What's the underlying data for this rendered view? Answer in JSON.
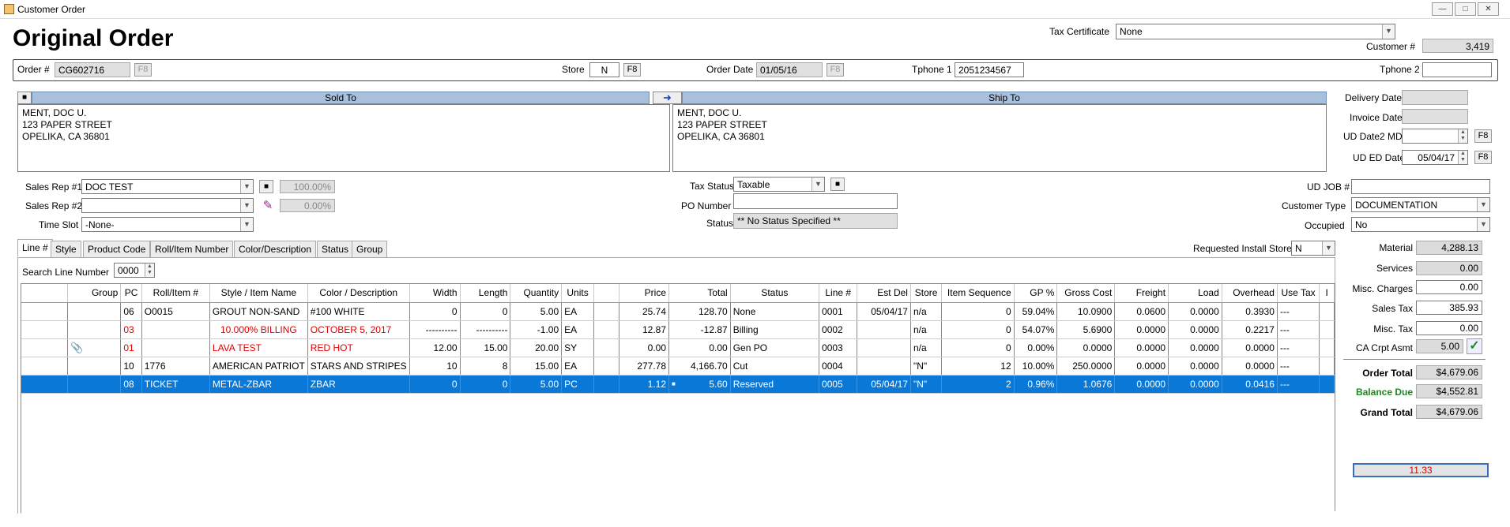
{
  "window": {
    "title": "Customer Order"
  },
  "page_title": "Original Order",
  "header": {
    "tax_certificate_label": "Tax Certificate",
    "tax_certificate_value": "None",
    "customer_no_label": "Customer #",
    "customer_no_value": "3,419",
    "order_no_label": "Order #",
    "order_no_value": "CG602716",
    "f8": "F8",
    "store_label": "Store",
    "store_value": "N",
    "order_date_label": "Order Date",
    "order_date_value": "01/05/16",
    "tphone1_label": "Tphone 1",
    "tphone1_value": "2051234567",
    "tphone2_label": "Tphone 2",
    "tphone2_value": ""
  },
  "sold_to": {
    "label": "Sold To",
    "lines": [
      "MENT, DOC U.",
      "123 PAPER STREET",
      "OPELIKA, CA  36801"
    ]
  },
  "ship_to": {
    "label": "Ship To",
    "lines": [
      "MENT, DOC U.",
      "123 PAPER STREET",
      "OPELIKA, CA  36801"
    ]
  },
  "dates": {
    "delivery_date_label": "Delivery Date",
    "invoice_date_label": "Invoice Date",
    "ud_date2_label": "UD Date2 MD",
    "ud_ed_date_label": "UD ED Date",
    "ud_ed_date_value": "05/04/17"
  },
  "sales": {
    "rep1_label": "Sales Rep #1",
    "rep1_value": "DOC TEST",
    "rep1_pct": "100.00%",
    "rep2_label": "Sales Rep #2",
    "rep2_value": "",
    "rep2_pct": "0.00%",
    "time_slot_label": "Time Slot",
    "time_slot_value": "-None-"
  },
  "status_block": {
    "tax_status_label": "Tax Status",
    "tax_status_value": "Taxable",
    "po_number_label": "PO Number",
    "po_number_value": "",
    "status_label": "Status",
    "status_value": "** No Status Specified **"
  },
  "ud": {
    "ud_job_label": "UD JOB #",
    "ud_job_value": "",
    "customer_type_label": "Customer Type",
    "customer_type_value": "DOCUMENTATION",
    "occupied_label": "Occupied",
    "occupied_value": "No"
  },
  "tabs": [
    "Line #",
    "Style",
    "Product Code",
    "Roll/Item Number",
    "Color/Description",
    "Status",
    "Group"
  ],
  "requested_install_store_label": "Requested Install Store",
  "requested_install_store_value": "N",
  "search_line_label": "Search Line Number",
  "search_line_value": "0000",
  "grid": {
    "columns": [
      "",
      "Group",
      "PC",
      "Roll/Item #",
      "Style / Item Name",
      "Color / Description",
      "Width",
      "Length",
      "Quantity",
      "Units",
      "",
      "Price",
      "Total",
      "Status",
      "Line #",
      "Est Del",
      "Store",
      "Item Sequence",
      "GP %",
      "Gross Cost",
      "Freight",
      "Load",
      "Overhead",
      "Use Tax",
      "I"
    ],
    "rows": [
      {
        "red": false,
        "attach": false,
        "cells": [
          "",
          "",
          "06",
          "O0015",
          "GROUT NON-SAND",
          "#100 WHITE",
          "0",
          "0",
          "5.00",
          "EA",
          "",
          "25.74",
          "128.70",
          "None",
          "0001",
          "05/04/17",
          "n/a",
          "0",
          "59.04%",
          "10.0900",
          "0.0600",
          "0.0000",
          "0.3930",
          "---",
          ""
        ]
      },
      {
        "red": true,
        "attach": false,
        "cells": [
          "",
          "",
          "03",
          "",
          "10.000% BILLING",
          "OCTOBER  5, 2017",
          "----------",
          "----------",
          "-1.00",
          "EA",
          "",
          "12.87",
          "-12.87",
          "Billing",
          "0002",
          "",
          "n/a",
          "0",
          "54.07%",
          "5.6900",
          "0.0000",
          "0.0000",
          "0.2217",
          "---",
          ""
        ]
      },
      {
        "red": true,
        "attach": true,
        "cells": [
          "",
          "",
          "01",
          "",
          "LAVA TEST",
          "RED HOT",
          "12.00",
          "15.00",
          "20.00",
          "SY",
          "",
          "0.00",
          "0.00",
          "Gen PO",
          "0003",
          "",
          "n/a",
          "0",
          "0.00%",
          "0.0000",
          "0.0000",
          "0.0000",
          "0.0000",
          "---",
          ""
        ]
      },
      {
        "red": false,
        "attach": false,
        "cells": [
          "",
          "",
          "10",
          "1776",
          "AMERICAN PATRIOT",
          "STARS AND STRIPES",
          "10",
          "8",
          "15.00",
          "EA",
          "",
          "277.78",
          "4,166.70",
          "Cut",
          "0004",
          "",
          "\"N\"",
          "12",
          "10.00%",
          "250.0000",
          "0.0000",
          "0.0000",
          "0.0000",
          "---",
          ""
        ]
      },
      {
        "red": false,
        "attach": false,
        "selected": true,
        "cells": [
          "",
          "",
          "08",
          "TICKET",
          "METAL-ZBAR",
          "ZBAR",
          "0",
          "0",
          "5.00",
          "PC",
          "",
          "1.12",
          "5.60",
          "Reserved",
          "0005",
          "05/04/17",
          "\"N\"",
          "2",
          "0.96%",
          "1.0676",
          "0.0000",
          "0.0000",
          "0.0416",
          "---",
          ""
        ]
      }
    ]
  },
  "summary": {
    "material_label": "Material",
    "material_value": "4,288.13",
    "services_label": "Services",
    "services_value": "0.00",
    "misc_charges_label": "Misc. Charges",
    "misc_charges_value": "0.00",
    "sales_tax_label": "Sales Tax",
    "sales_tax_value": "385.93",
    "misc_tax_label": "Misc. Tax",
    "misc_tax_value": "0.00",
    "ca_crpt_label": "CA Crpt Asmt",
    "ca_crpt_value": "5.00",
    "order_total_label": "Order Total",
    "order_total_value": "$4,679.06",
    "balance_due_label": "Balance Due",
    "balance_due_value": "$4,552.81",
    "grand_total_label": "Grand Total",
    "grand_total_value": "$4,679.06",
    "bottom_value": "11.33"
  },
  "colors": {
    "selection": "#0a78d7",
    "header_bar": "#a9c0dc",
    "red_text": "#e00000",
    "balance_green": "#1b8a1b"
  }
}
